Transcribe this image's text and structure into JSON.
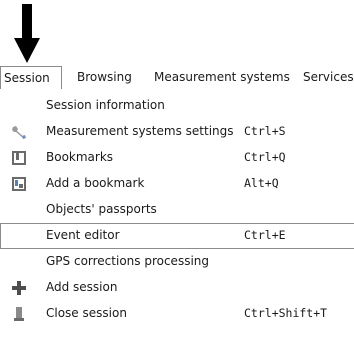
{
  "menubar": {
    "items": [
      {
        "label": "Session"
      },
      {
        "label": "Browsing"
      },
      {
        "label": "Measurement systems"
      },
      {
        "label": "Services"
      }
    ]
  },
  "session_menu": {
    "items": [
      {
        "label": "Session information",
        "shortcut": "",
        "icon": ""
      },
      {
        "label": "Measurement systems settings",
        "shortcut": "Ctrl+S",
        "icon": "wrench-icon"
      },
      {
        "label": "Bookmarks",
        "shortcut": "Ctrl+Q",
        "icon": "bookmarks-icon"
      },
      {
        "label": "Add a bookmark",
        "shortcut": "Alt+Q",
        "icon": "add-bookmark-icon"
      },
      {
        "label": "Objects' passports",
        "shortcut": "",
        "icon": ""
      },
      {
        "label": "Event editor",
        "shortcut": "Ctrl+E",
        "icon": ""
      },
      {
        "label": "GPS corrections processing",
        "shortcut": "",
        "icon": ""
      },
      {
        "label": "Add session",
        "shortcut": "",
        "icon": "add-session-icon"
      },
      {
        "label": "Close session",
        "shortcut": "Ctrl+Shift+T",
        "icon": "close-session-icon"
      }
    ]
  }
}
